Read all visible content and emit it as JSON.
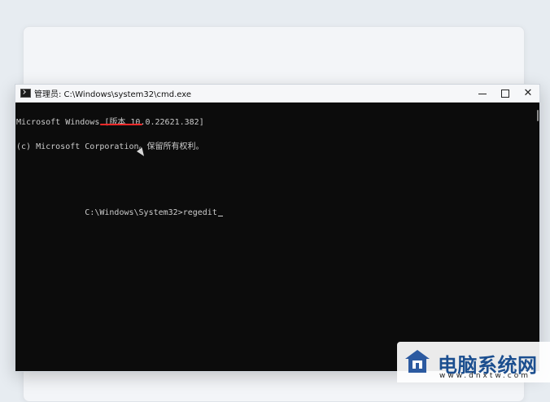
{
  "window": {
    "title": "管理员: C:\\Windows\\system32\\cmd.exe",
    "controls": {
      "minimize": "",
      "maximize": "",
      "close": "✕"
    }
  },
  "console": {
    "lines": [
      "Microsoft Windows [版本 10.0.22621.382]",
      "(c) Microsoft Corporation。保留所有权利。",
      "",
      "C:\\Windows\\System32>regedit"
    ]
  },
  "watermark": {
    "brand": "电脑系统网",
    "site": "www.dnxtw.com"
  },
  "colors": {
    "console_bg": "#0c0c0c",
    "console_text": "#cccccc",
    "highlight": "#ff2b2b",
    "brand": "#1b4e8f"
  },
  "icons": {
    "window": "cmd-icon",
    "mouse": "mouse-cursor-icon",
    "logo": "house-logo-icon"
  }
}
